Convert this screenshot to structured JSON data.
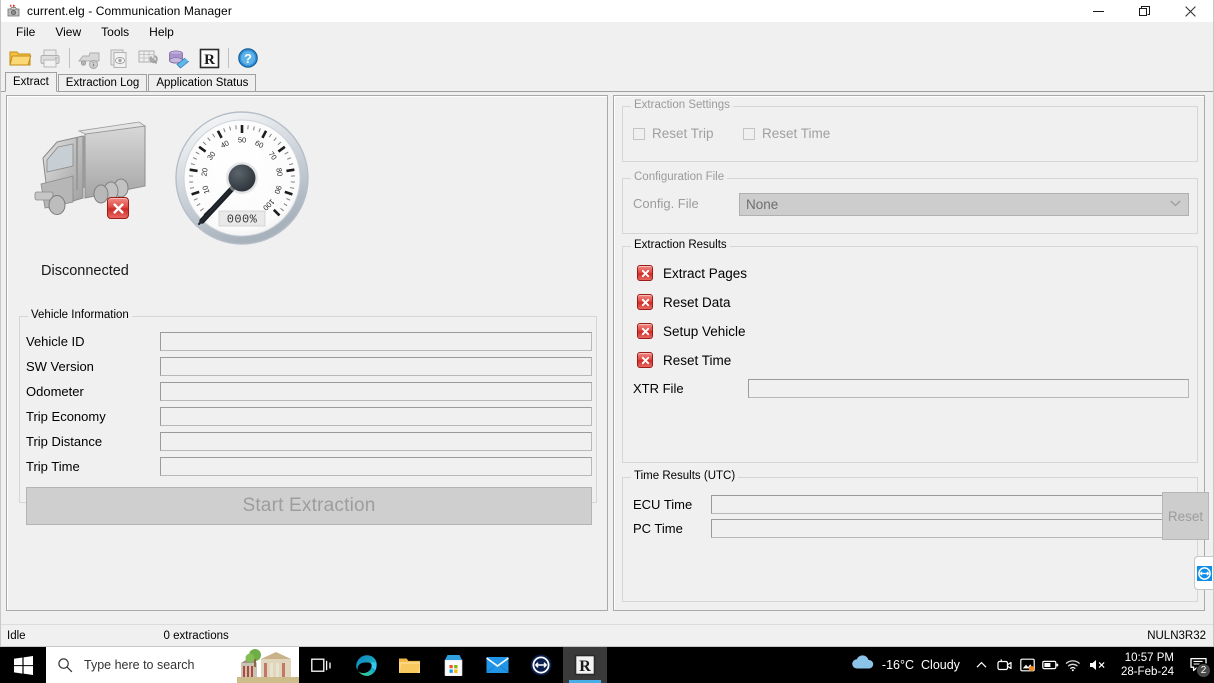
{
  "window": {
    "title": "current.elg - Communication Manager",
    "icon": "app-camera-icon",
    "minimize_label": "–",
    "maximize_label": "❐",
    "close_label": "✕"
  },
  "menubar": {
    "items": [
      {
        "label": "File",
        "name": "menu-file"
      },
      {
        "label": "View",
        "name": "menu-view"
      },
      {
        "label": "Tools",
        "name": "menu-tools"
      },
      {
        "label": "Help",
        "name": "menu-help"
      }
    ]
  },
  "toolbar": {
    "buttons": [
      {
        "name": "open-file-icon",
        "title": "Open",
        "enabled": true
      },
      {
        "name": "print-icon",
        "title": "Print",
        "enabled": false
      },
      {
        "name": "truck-info-icon",
        "title": "Vehicle Info",
        "enabled": false
      },
      {
        "name": "document-view-icon",
        "title": "View Document",
        "enabled": false
      },
      {
        "name": "table-settings-icon",
        "title": "Configure",
        "enabled": false
      },
      {
        "name": "database-connect-icon",
        "title": "Connect",
        "enabled": true
      },
      {
        "name": "r-logo-icon",
        "title": "R",
        "enabled": true
      },
      {
        "name": "help-icon",
        "title": "Help",
        "enabled": true
      }
    ]
  },
  "tabs": [
    {
      "label": "Extract",
      "name": "tab-extract",
      "active": true
    },
    {
      "label": "Extraction Log",
      "name": "tab-extraction-log",
      "active": false
    },
    {
      "label": "Application Status",
      "name": "tab-application-status",
      "active": false
    }
  ],
  "status_panel": {
    "connection_status": "Disconnected",
    "gauge": {
      "value_text": "000%",
      "tick_labels": [
        "10",
        "20",
        "30",
        "40",
        "50",
        "60",
        "70",
        "80",
        "90",
        "100"
      ],
      "needle_value": 0,
      "min": 0,
      "max": 100
    }
  },
  "vehicle_information": {
    "title": "Vehicle Information",
    "fields": [
      {
        "label": "Vehicle ID",
        "value": "",
        "name": "vehicle-id-field"
      },
      {
        "label": "SW Version",
        "value": "",
        "name": "sw-version-field"
      },
      {
        "label": "Odometer",
        "value": "",
        "name": "odometer-field"
      },
      {
        "label": "Trip Economy",
        "value": "",
        "name": "trip-economy-field"
      },
      {
        "label": "Trip Distance",
        "value": "",
        "name": "trip-distance-field"
      },
      {
        "label": "Trip Time",
        "value": "",
        "name": "trip-time-field"
      }
    ],
    "start_button": {
      "label": "Start Extraction",
      "enabled": false
    }
  },
  "extraction_settings": {
    "title": "Extraction Settings",
    "enabled": false,
    "checkboxes": [
      {
        "label": "Reset Trip",
        "checked": false,
        "name": "reset-trip-checkbox"
      },
      {
        "label": "Reset Time",
        "checked": false,
        "name": "reset-time-checkbox"
      }
    ]
  },
  "configuration_file": {
    "title": "Configuration File",
    "enabled": false,
    "label": "Config. File",
    "selected": "None",
    "options": [
      "None"
    ]
  },
  "extraction_results": {
    "title": "Extraction Results",
    "items": [
      {
        "label": "Extract Pages",
        "status": "failed",
        "name": "result-extract-pages"
      },
      {
        "label": "Reset Data",
        "status": "failed",
        "name": "result-reset-data"
      },
      {
        "label": "Setup Vehicle",
        "status": "failed",
        "name": "result-setup-vehicle"
      },
      {
        "label": "Reset Time",
        "status": "failed",
        "name": "result-reset-time"
      }
    ],
    "xtr_file": {
      "label": "XTR File",
      "value": ""
    }
  },
  "time_results": {
    "title": "Time Results (UTC)",
    "rows": [
      {
        "label": "ECU Time",
        "value": "",
        "name": "ecu-time-field"
      },
      {
        "label": "PC Time",
        "value": "",
        "name": "pc-time-field"
      }
    ],
    "reset_button": {
      "label": "Reset",
      "enabled": false
    }
  },
  "statusbar": {
    "state": "Idle",
    "extractions": "0 extractions",
    "machine": "NULN3R32"
  },
  "taskbar": {
    "search_placeholder": "Type here to search",
    "icons": [
      {
        "name": "task-view-icon",
        "active": false
      },
      {
        "name": "microsoft-edge-icon",
        "active": false
      },
      {
        "name": "file-explorer-icon",
        "active": false
      },
      {
        "name": "microsoft-store-icon",
        "active": false
      },
      {
        "name": "mail-icon",
        "active": false
      },
      {
        "name": "teamviewer-icon",
        "active": false
      },
      {
        "name": "communication-manager-icon",
        "active": true
      }
    ],
    "weather": {
      "temperature": "-16°C",
      "condition": "Cloudy"
    },
    "clock": {
      "time": "10:57 PM",
      "date": "28-Feb-24"
    },
    "notifications": "2"
  },
  "colors": {
    "accent": "#0078d7",
    "error_red": "#cf2b26",
    "window_bg": "#f0f0f0",
    "taskbar_bg": "#000000"
  }
}
